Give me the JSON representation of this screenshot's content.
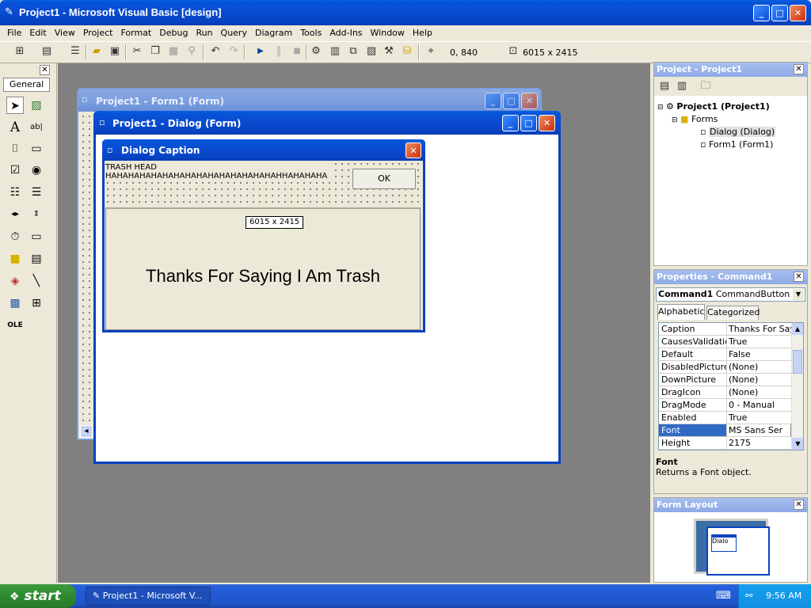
{
  "window": {
    "title": "Project1 - Microsoft Visual Basic [design]"
  },
  "menu": [
    "File",
    "Edit",
    "View",
    "Project",
    "Format",
    "Debug",
    "Run",
    "Query",
    "Diagram",
    "Tools",
    "Add-Ins",
    "Window",
    "Help"
  ],
  "toolbar": {
    "position": "0, 840",
    "size": "6015 x 2415"
  },
  "toolbox": {
    "tab_label": "General"
  },
  "form1": {
    "title": "Project1 - Form1 (Form)"
  },
  "dialog_form": {
    "title": "Project1 - Dialog (Form)"
  },
  "dialog_preview": {
    "caption": "Dialog Caption",
    "label_text": "TRASH HEAD\nHAHAHAHAHAHAHAHAHAHAHAHAHAHAHAHHAHAHAHA",
    "ok_label": "OK",
    "size_tooltip": "6015 x 2415",
    "command_caption": "Thanks For Saying I Am Trash"
  },
  "project_panel": {
    "title": "Project - Project1",
    "root": "Project1 (Project1)",
    "forms_folder": "Forms",
    "items": [
      "Dialog (Dialog)",
      "Form1 (Form1)"
    ]
  },
  "properties_panel": {
    "title": "Properties - Command1",
    "object_name": "Command1",
    "object_type": "CommandButton",
    "tab_alphabetic": "Alphabetic",
    "tab_categorized": "Categorized",
    "rows": [
      {
        "name": "Caption",
        "value": "Thanks For Sayi"
      },
      {
        "name": "CausesValidation",
        "value": "True"
      },
      {
        "name": "Default",
        "value": "False"
      },
      {
        "name": "DisabledPicture",
        "value": "(None)"
      },
      {
        "name": "DownPicture",
        "value": "(None)"
      },
      {
        "name": "DragIcon",
        "value": "(None)"
      },
      {
        "name": "DragMode",
        "value": "0 - Manual"
      },
      {
        "name": "Enabled",
        "value": "True"
      },
      {
        "name": "Font",
        "value": "MS Sans Ser"
      },
      {
        "name": "Height",
        "value": "2175"
      }
    ],
    "desc_title": "Font",
    "desc_text": "Returns a Font object."
  },
  "form_layout": {
    "title": "Form Layout",
    "mini_label": "Dialo"
  },
  "taskbar": {
    "start": "start",
    "task": "Project1 - Microsoft V...",
    "clock": "9:56 AM"
  }
}
